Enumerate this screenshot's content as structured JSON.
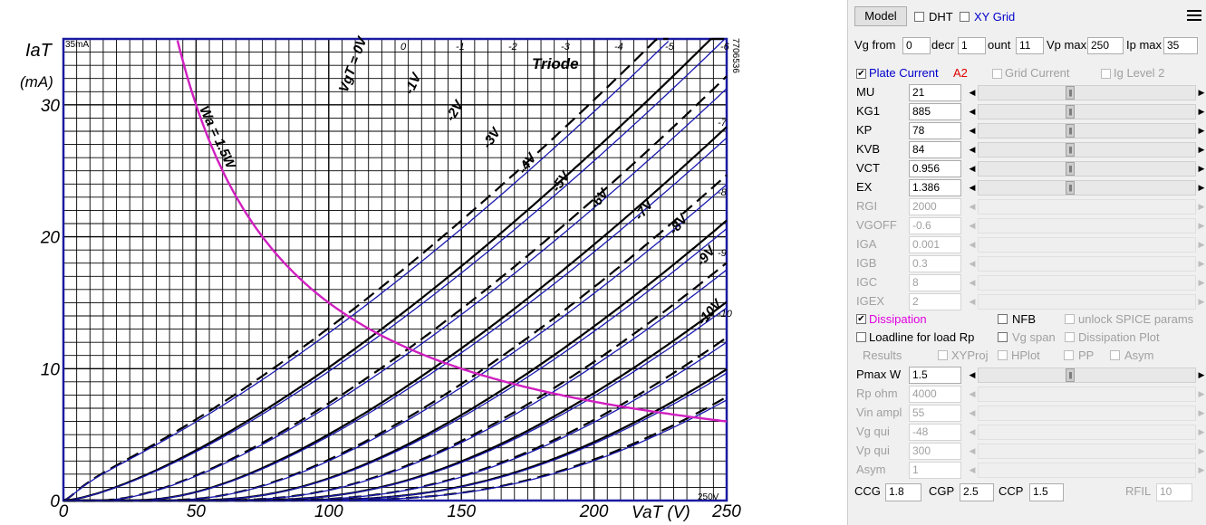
{
  "plot": {
    "tube_label": "Triode",
    "side_code": "7706536",
    "scale_top": "35mA",
    "scale_right": "250V",
    "y_axis_label_line1": "IaT",
    "y_axis_label_unit": "(mA)",
    "x_axis_label": "VaT (V)",
    "dissipation_label": "Wa = 1.5W",
    "x_ticks": [
      "0",
      "50",
      "100",
      "150",
      "200",
      "250"
    ],
    "y_ticks": [
      "0",
      "10",
      "20",
      "30"
    ],
    "curve_labels": [
      "VgT = 0V",
      "-1V",
      "-2V",
      "-3V",
      "-4V",
      "-5V",
      "-6V",
      "-7V",
      "-8V",
      "-9V",
      "-10V"
    ],
    "grid_top_labels": [
      "0",
      "-1",
      "-2",
      "-3",
      "-4",
      "-5",
      "-6"
    ],
    "grid_right_labels": [
      "-7",
      "-8",
      "-9",
      "-10"
    ],
    "chart_data": {
      "type": "line",
      "xlabel": "VaT (V)",
      "ylabel": "IaT (mA)",
      "xlim": [
        0,
        250
      ],
      "ylim": [
        0,
        35
      ],
      "grid": true,
      "series": [
        {
          "name": "VgT = 0V",
          "vg": 0
        },
        {
          "name": "-1V",
          "vg": -1
        },
        {
          "name": "-2V",
          "vg": -2
        },
        {
          "name": "-3V",
          "vg": -3
        },
        {
          "name": "-4V",
          "vg": -4
        },
        {
          "name": "-5V",
          "vg": -5
        },
        {
          "name": "-6V",
          "vg": -6
        },
        {
          "name": "-7V",
          "vg": -7
        },
        {
          "name": "-8V",
          "vg": -8
        },
        {
          "name": "-9V",
          "vg": -9
        },
        {
          "name": "-10V",
          "vg": -10
        }
      ],
      "dissipation_watts": 1.5,
      "model": {
        "mu": 21,
        "kg1": 885,
        "kp": 78,
        "kvb": 84,
        "vct": 0.956,
        "ex": 1.386
      }
    }
  },
  "panel": {
    "model_button": "Model",
    "dht_label": "DHT",
    "xygrid_label": "XY Grid",
    "row2": {
      "vg_from_label": "Vg from",
      "vg_from": "0",
      "decr_label": "decr",
      "decr": "1",
      "count_label": "ount",
      "count": "11",
      "vpmax_label": "Vp max",
      "vpmax": "250",
      "ipmax_label": "Ip max",
      "ipmax": "35"
    },
    "plate_current_label": "Plate Current",
    "a2_label": "A2",
    "grid_current_label": "Grid Current",
    "ig_level_label": "Ig Level 2",
    "params": [
      {
        "name": "MU",
        "value": "21",
        "enabled": true,
        "pos": 0.42
      },
      {
        "name": "KG1",
        "value": "885",
        "enabled": true,
        "pos": 0.42
      },
      {
        "name": "KP",
        "value": "78",
        "enabled": true,
        "pos": 0.42
      },
      {
        "name": "KVB",
        "value": "84",
        "enabled": true,
        "pos": 0.42
      },
      {
        "name": "VCT",
        "value": "0.956",
        "enabled": true,
        "pos": 0.42
      },
      {
        "name": "EX",
        "value": "1.386",
        "enabled": true,
        "pos": 0.42
      },
      {
        "name": "RGI",
        "value": "2000",
        "enabled": false
      },
      {
        "name": "VGOFF",
        "value": "-0.6",
        "enabled": false
      },
      {
        "name": "IGA",
        "value": "0.001",
        "enabled": false
      },
      {
        "name": "IGB",
        "value": "0.3",
        "enabled": false
      },
      {
        "name": "IGC",
        "value": "8",
        "enabled": false
      },
      {
        "name": "IGEX",
        "value": "2",
        "enabled": false
      }
    ],
    "dissipation_label": "Dissipation",
    "nfb_label": "NFB",
    "unlock_label": "unlock SPICE params",
    "loadline_label": "Loadline for load Rp",
    "vgspan_label": "Vg span",
    "dissplot_label": "Dissipation Plot",
    "results_label": "Results",
    "xyproj_label": "XYProj",
    "hplot_label": "HPlot",
    "pp_label": "PP",
    "asym_cb_label": "Asym",
    "params2": [
      {
        "name": "Pmax W",
        "value": "1.5",
        "enabled": true,
        "pos": 0.42
      },
      {
        "name": "Rp ohm",
        "value": "4000",
        "enabled": false
      },
      {
        "name": "Vin ampl",
        "value": "55",
        "enabled": false
      },
      {
        "name": "Vg qui",
        "value": "-48",
        "enabled": false
      },
      {
        "name": "Vp qui",
        "value": "300",
        "enabled": false
      },
      {
        "name": "Asym",
        "value": "1",
        "enabled": false
      }
    ],
    "ccg_label": "CCG",
    "ccg": "1.8",
    "cgp_label": "CGP",
    "cgp": "2.5",
    "ccp_label": "CCP",
    "ccp": "1.5",
    "rfil_label": "RFIL",
    "rfil": "10"
  }
}
